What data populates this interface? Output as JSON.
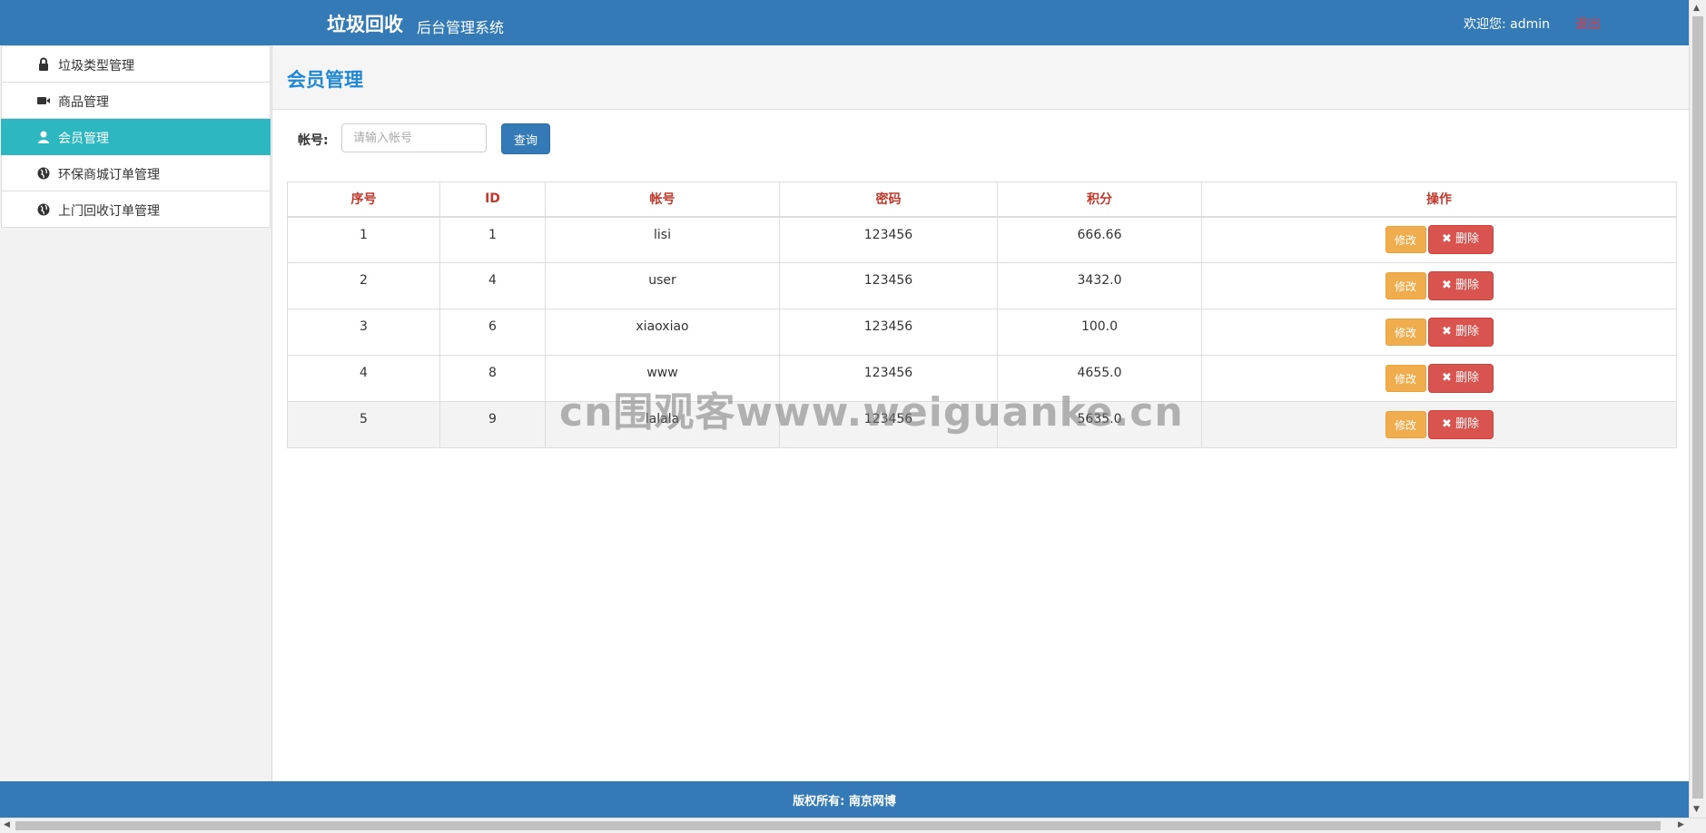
{
  "header": {
    "brand": "垃圾回收",
    "subtitle": "后台管理系统",
    "welcome": "欢迎您: admin",
    "logout": "退出"
  },
  "sidebar": {
    "items": [
      {
        "label": "垃圾类型管理",
        "icon": "lock-icon"
      },
      {
        "label": "商品管理",
        "icon": "video-icon"
      },
      {
        "label": "会员管理",
        "icon": "user-icon",
        "active": true
      },
      {
        "label": "环保商城订单管理",
        "icon": "globe-icon"
      },
      {
        "label": "上门回收订单管理",
        "icon": "globe-icon"
      }
    ]
  },
  "main": {
    "title": "会员管理",
    "search": {
      "label": "帐号:",
      "placeholder": "请输入帐号",
      "value": "",
      "button": "查询"
    },
    "table": {
      "headers": [
        "序号",
        "ID",
        "帐号",
        "密码",
        "积分",
        "操作"
      ],
      "rows": [
        [
          "1",
          "1",
          "lisi",
          "123456",
          "666.66"
        ],
        [
          "2",
          "4",
          "user",
          "123456",
          "3432.0"
        ],
        [
          "3",
          "6",
          "xiaoxiao",
          "123456",
          "100.0"
        ],
        [
          "4",
          "8",
          "www",
          "123456",
          "4655.0"
        ],
        [
          "5",
          "9",
          "lalala",
          "123456",
          "5635.0"
        ]
      ],
      "edit_label": "修改",
      "delete_label": "删除"
    }
  },
  "watermark": "cn围观客www.weiguanke.cn",
  "footer": {
    "text": "版权所有: 南京网博"
  },
  "colors": {
    "header": "#337ab7",
    "active_nav": "#2cb7c1",
    "title": "#2189d4",
    "header_text": "#c0392b",
    "edit_button": "#f0ad4e",
    "delete_button": "#d9534f",
    "logout": "#e8353b"
  }
}
